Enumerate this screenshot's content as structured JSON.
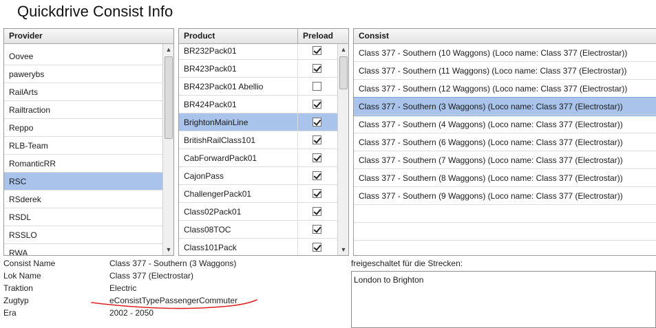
{
  "window": {
    "title": "Quickdrive Consist Info"
  },
  "provider": {
    "header": "Provider",
    "items": [
      "Oovee",
      "pawerybs",
      "RailArts",
      "Railtraction",
      "Reppo",
      "RLB-Team",
      "RomanticRR",
      "RSC",
      "RSderek",
      "RSDL",
      "RSSLO",
      "RWA"
    ],
    "selected_index": 7
  },
  "product": {
    "headers": {
      "name": "Product",
      "preload": "Preload"
    },
    "items": [
      {
        "name": "BR232Pack01",
        "preload": true
      },
      {
        "name": "BR423Pack01",
        "preload": true
      },
      {
        "name": "BR423Pack01 Abellio",
        "preload": false
      },
      {
        "name": "BR424Pack01",
        "preload": true
      },
      {
        "name": "BrightonMainLine",
        "preload": true
      },
      {
        "name": "BritishRailClass101",
        "preload": true
      },
      {
        "name": "CabForwardPack01",
        "preload": true
      },
      {
        "name": "CajonPass",
        "preload": true
      },
      {
        "name": "ChallengerPack01",
        "preload": true
      },
      {
        "name": "Class02Pack01",
        "preload": true
      },
      {
        "name": "Class08TOC",
        "preload": true
      },
      {
        "name": "Class101Pack",
        "preload": true
      }
    ],
    "selected_index": 4
  },
  "consist": {
    "header": "Consist",
    "items": [
      "Class 377 - Southern (10 Waggons)  (Loco name: Class 377 (Electrostar))",
      "Class 377 - Southern (11 Waggons)  (Loco name: Class 377 (Electrostar))",
      "Class 377 - Southern (12 Waggons)  (Loco name: Class 377 (Electrostar))",
      "Class 377 - Southern (3 Waggons)  (Loco name: Class 377 (Electrostar))",
      "Class 377 - Southern (4 Waggons)  (Loco name: Class 377 (Electrostar))",
      "Class 377 - Southern (6 Waggons)  (Loco name: Class 377 (Electrostar))",
      "Class 377 - Southern (7 Waggons)  (Loco name: Class 377 (Electrostar))",
      "Class 377 - Southern (8 Waggons)  (Loco name: Class 377 (Electrostar))",
      "Class 377 - Southern (9 Waggons)  (Loco name: Class 377 (Electrostar))"
    ],
    "selected_index": 3
  },
  "details": [
    {
      "label": "Consist Name",
      "value": "Class 377 - Southern (3 Waggons)"
    },
    {
      "label": "Lok Name",
      "value": "Class 377 (Electrostar)"
    },
    {
      "label": "Traktion",
      "value": "Electric"
    },
    {
      "label": "Zugtyp",
      "value": "eConsistTypePassengerCommuter"
    },
    {
      "label": "Era",
      "value": "2002 - 2050"
    }
  ],
  "routes": {
    "label": "freigeschaltet für die Strecken:",
    "items": [
      "London to Brighton"
    ]
  },
  "icons": {
    "scroll_up": "arrow-up-icon",
    "scroll_down": "arrow-down-icon"
  },
  "colors": {
    "selection": "#a9c3ea",
    "annotation": "#e02020"
  }
}
